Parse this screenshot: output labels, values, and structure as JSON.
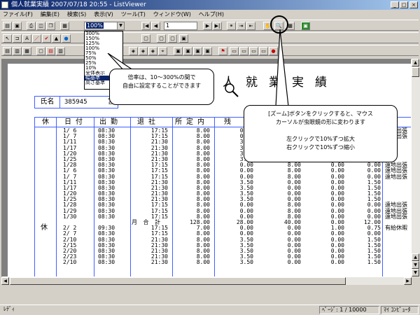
{
  "window": {
    "title": "個人就業実績 2007/07/18 20:55 - ListViewer"
  },
  "menu": [
    "ファイル(F)",
    "編集(E)",
    "検索(S)",
    "表示(V)",
    "ツール(T)",
    "ウィンドウ(W)",
    "ヘルプ(H)"
  ],
  "toolbar": {
    "zoom_value": "100%",
    "page_value": "1",
    "zoom_options": [
      "300%",
      "150%",
      "125%",
      "100%",
      "75%",
      "50%",
      "25%",
      "10%",
      "全体表示",
      "幅基準",
      "高さ基準"
    ],
    "zoom_highlight_index": 9
  },
  "report": {
    "title": "個人就業実績",
    "name_label": "氏名",
    "employee_id": "385945",
    "name_value": "宮",
    "headers": [
      "休",
      "日付",
      "出勤",
      "退社",
      "所定内",
      "残"
    ],
    "rows": [
      {
        "hol": "",
        "date": "1/ 6",
        "in": "08:30",
        "out": "17:15",
        "wk": "8.00",
        "ot": "0.00",
        "ot2": "",
        "ot3": "",
        "ot4": "",
        "note": "遠地出張"
      },
      {
        "hol": "",
        "date": "1/ 7",
        "in": "08:30",
        "out": "17:15",
        "wk": "8.00",
        "ot": "0.00",
        "ot2": "",
        "ot3": "",
        "ot4": "",
        "note": "遠地出張"
      },
      {
        "hol": "",
        "date": "1/11",
        "in": "08:30",
        "out": "21:30",
        "wk": "8.00",
        "ot": "3.50",
        "ot2": "",
        "ot3": "",
        "ot4": "",
        "note": ""
      },
      {
        "hol": "",
        "date": "1/17",
        "in": "08:30",
        "out": "21:30",
        "wk": "8.00",
        "ot": "3.50",
        "ot2": "",
        "ot3": "",
        "ot4": "",
        "note": ""
      },
      {
        "hol": "",
        "date": "1/20",
        "in": "08:30",
        "out": "21:30",
        "wk": "8.00",
        "ot": "3.50",
        "ot2": "",
        "ot3": "",
        "ot4": "",
        "note": ""
      },
      {
        "hol": "",
        "date": "1/25",
        "in": "08:30",
        "out": "21:30",
        "wk": "8.00",
        "ot": "3.50",
        "ot2": "0.00",
        "ot3": "0.00",
        "ot4": "1.50",
        "note": ""
      },
      {
        "hol": "",
        "date": "1/28",
        "in": "08:30",
        "out": "17:15",
        "wk": "8.00",
        "ot": "0.00",
        "ot2": "8.00",
        "ot3": "0.00",
        "ot4": "0.00",
        "note": "遠地出張"
      },
      {
        "hol": "",
        "date": "1/ 6",
        "in": "08:30",
        "out": "17:15",
        "wk": "8.00",
        "ot": "0.00",
        "ot2": "8.00",
        "ot3": "0.00",
        "ot4": "0.00",
        "note": "遠地出張"
      },
      {
        "hol": "",
        "date": "1/ 7",
        "in": "08:30",
        "out": "17:15",
        "wk": "8.00",
        "ot": "0.00",
        "ot2": "8.00",
        "ot3": "0.00",
        "ot4": "0.00",
        "note": "遠地出張"
      },
      {
        "hol": "",
        "date": "1/11",
        "in": "08:30",
        "out": "21:30",
        "wk": "8.00",
        "ot": "3.50",
        "ot2": "0.00",
        "ot3": "0.00",
        "ot4": "1.50",
        "note": ""
      },
      {
        "hol": "",
        "date": "1/17",
        "in": "08:30",
        "out": "21:30",
        "wk": "8.00",
        "ot": "3.50",
        "ot2": "0.00",
        "ot3": "0.00",
        "ot4": "1.50",
        "note": ""
      },
      {
        "hol": "",
        "date": "1/20",
        "in": "08:30",
        "out": "21:30",
        "wk": "8.00",
        "ot": "3.50",
        "ot2": "0.00",
        "ot3": "0.00",
        "ot4": "1.50",
        "note": ""
      },
      {
        "hol": "",
        "date": "1/25",
        "in": "08:30",
        "out": "21:30",
        "wk": "8.00",
        "ot": "3.50",
        "ot2": "0.00",
        "ot3": "0.00",
        "ot4": "1.50",
        "note": ""
      },
      {
        "hol": "",
        "date": "1/28",
        "in": "08:30",
        "out": "17:15",
        "wk": "8.00",
        "ot": "0.00",
        "ot2": "8.00",
        "ot3": "0.00",
        "ot4": "0.00",
        "note": "遠地出張"
      },
      {
        "hol": "",
        "date": "1/29",
        "in": "08:30",
        "out": "17:15",
        "wk": "8.00",
        "ot": "0.00",
        "ot2": "8.00",
        "ot3": "0.00",
        "ot4": "0.00",
        "note": "遠地出張"
      },
      {
        "hol": "",
        "date": "1/30",
        "in": "08:30",
        "out": "17:15",
        "wk": "8.00",
        "ot": "0.00",
        "ot2": "8.00",
        "ot3": "0.00",
        "ot4": "0.00",
        "note": "遠地出張"
      },
      {
        "hol": "",
        "date": "",
        "in": "",
        "out": "月 合 計",
        "wk": "128.00",
        "ot": "28.00",
        "ot2": "40.00",
        "ot3": "0.00",
        "ot4": "12.00",
        "note": "",
        "total": true
      },
      {
        "hol": "休",
        "date": "2/ 2",
        "in": "09:30",
        "out": "17:15",
        "wk": "7.00",
        "ot": "0.00",
        "ot2": "0.00",
        "ot3": "1.00",
        "ot4": "0.75",
        "note": "有給休暇"
      },
      {
        "hol": "",
        "date": "2/ 7",
        "in": "08:30",
        "out": "17:15",
        "wk": "8.00",
        "ot": "0.00",
        "ot2": "0.00",
        "ot3": "0.00",
        "ot4": "0.00",
        "note": ""
      },
      {
        "hol": "",
        "date": "2/10",
        "in": "08:30",
        "out": "21:30",
        "wk": "8.00",
        "ot": "3.50",
        "ot2": "0.00",
        "ot3": "0.00",
        "ot4": "1.50",
        "note": ""
      },
      {
        "hol": "",
        "date": "2/15",
        "in": "08:30",
        "out": "21:30",
        "wk": "8.00",
        "ot": "3.50",
        "ot2": "0.00",
        "ot3": "0.00",
        "ot4": "1.50",
        "note": ""
      },
      {
        "hol": "",
        "date": "2/20",
        "in": "08:30",
        "out": "21:30",
        "wk": "8.00",
        "ot": "3.50",
        "ot2": "0.00",
        "ot3": "0.00",
        "ot4": "1.50",
        "note": ""
      },
      {
        "hol": "",
        "date": "2/23",
        "in": "08:30",
        "out": "21:30",
        "wk": "8.00",
        "ot": "3.50",
        "ot2": "0.00",
        "ot3": "0.00",
        "ot4": "1.50",
        "note": ""
      },
      {
        "hol": "",
        "date": "2/10",
        "in": "08:30",
        "out": "21:30",
        "wk": "8.00",
        "ot": "3.50",
        "ot2": "0.00",
        "ot3": "0.00",
        "ot4": "1.50",
        "note": ""
      }
    ]
  },
  "callouts": {
    "zoom_range": "倍率は、10～300%の間で\n自由に設定することができます",
    "zoom_button": "[ズーム]ボタンをクリックすると、マウス\nカーソルが虫眼鏡の形に変わります\n\n左クリックで10%ずつ拡大\n右クリックで10%ずつ縮小"
  },
  "status": {
    "ready": "ﾚﾃﾞｨ",
    "page": "ﾍﾟｰｼﾞ: 1 / 10000",
    "location": "ﾏｲ ｺﾝﾋﾟｭｰﾀ"
  }
}
